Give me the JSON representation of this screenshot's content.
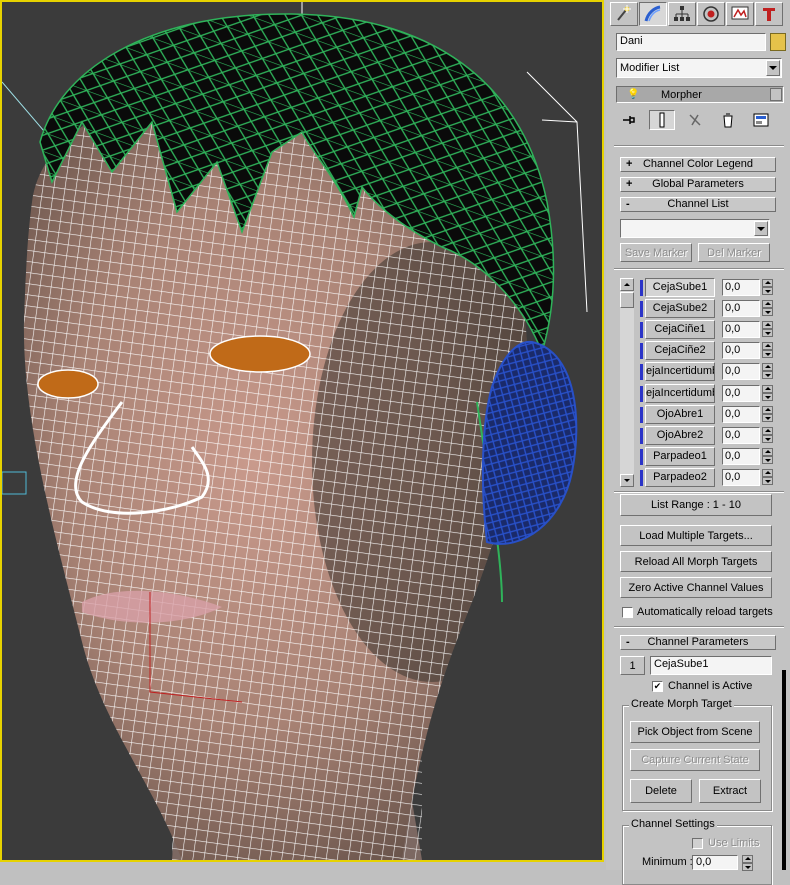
{
  "viewport": {
    "colors": {
      "background": "#3b3b3b",
      "frame": "#e6d200",
      "hair": "#2fb35a",
      "ear": "#2850c8",
      "wire": "#ffffff",
      "eyes": "#c06a18"
    }
  },
  "panel": {
    "tabs": [
      {
        "icon": "create-icon"
      },
      {
        "icon": "modify-icon"
      },
      {
        "icon": "hierarchy-icon"
      },
      {
        "icon": "motion-icon"
      },
      {
        "icon": "display-icon"
      },
      {
        "icon": "utilities-icon"
      }
    ],
    "object_name": "Dani",
    "object_color": "#e5c24a",
    "modifier_list": "Modifier List",
    "stack_item": "Morpher",
    "rollouts": {
      "color_legend": {
        "sign": "+",
        "label": "Channel Color Legend"
      },
      "global_params": {
        "sign": "+",
        "label": "Global Parameters"
      },
      "channel_list": {
        "sign": "-",
        "label": "Channel List"
      },
      "channel_params": {
        "sign": "-",
        "label": "Channel Parameters"
      }
    },
    "marker_select": "",
    "save_marker": "Save Marker",
    "del_marker": "Del Marker",
    "channels": [
      {
        "name": "CejaSube1",
        "value": "0,0"
      },
      {
        "name": "CejaSube2",
        "value": "0,0"
      },
      {
        "name": "CejaCiñe1",
        "value": "0,0"
      },
      {
        "name": "CejaCiñe2",
        "value": "0,0"
      },
      {
        "name": "ejaIncertidumbre",
        "value": "0,0"
      },
      {
        "name": "ejaIncertidumbre",
        "value": "0,0"
      },
      {
        "name": "OjoAbre1",
        "value": "0,0"
      },
      {
        "name": "OjoAbre2",
        "value": "0,0"
      },
      {
        "name": "Parpadeo1",
        "value": "0,0"
      },
      {
        "name": "Parpadeo2",
        "value": "0,0"
      }
    ],
    "list_range": "List Range :   1 - 10",
    "load_multiple": "Load Multiple Targets...",
    "reload_all": "Reload All Morph Targets",
    "zero_active": "Zero Active Channel Values",
    "auto_reload": "Automatically reload targets",
    "channel_number": "1",
    "channel_name": "CejaSube1",
    "channel_active": "Channel is Active",
    "create_group": "Create Morph Target",
    "pick_object": "Pick Object from Scene",
    "capture_state": "Capture Current State",
    "delete": "Delete",
    "extract": "Extract",
    "settings_group": "Channel Settings",
    "use_limits": "Use Limits",
    "minimum_label": "Minimum :",
    "minimum_value": "0,0"
  }
}
